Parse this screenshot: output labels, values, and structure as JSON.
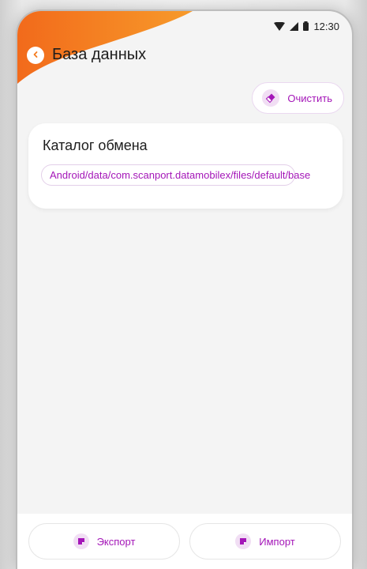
{
  "status_bar": {
    "time": "12:30"
  },
  "header": {
    "title": "База данных"
  },
  "clear_button": {
    "label": "Очистить"
  },
  "card": {
    "title": "Каталог обмена",
    "path": "Android/data/com.scanport.datamobilex/files/default/base"
  },
  "bottom_bar": {
    "export_label": "Экспорт",
    "import_label": "Импорт"
  },
  "colors": {
    "accent": "#a416b8",
    "brand_orange": "#f57c1f",
    "background": "#f4f4f4"
  },
  "icons": {
    "back": "chevron-left-icon",
    "clear": "eraser-icon",
    "export": "file-export-icon",
    "import": "file-import-icon",
    "wifi": "wifi-icon",
    "signal": "signal-icon",
    "battery": "battery-icon"
  }
}
